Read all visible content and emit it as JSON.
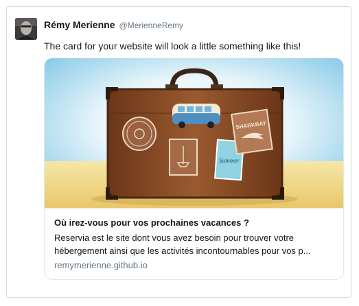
{
  "tweet": {
    "author": {
      "name": "Rémy Merienne",
      "handle": "@MerienneRemy"
    },
    "text": "The card for your website will look a little something like this!",
    "card": {
      "title": "Où irez-vous pour vos prochaines vacances ?",
      "description_line1": "Reservia est le site dont vous avez besoin pour trouver votre",
      "description_line2": "hébergement ainsi que les activités incontournables pour vos p...",
      "domain": "remymerienne.github.io",
      "image_labels": {
        "sticker_shark": "SHARKBAY",
        "sticker_summer": "Summer"
      }
    }
  },
  "colors": {
    "border": "#d5dde3",
    "handle": "#657786",
    "text": "#14171a",
    "suitcase": "#8b4a25",
    "sky": "#bfe6f5"
  }
}
